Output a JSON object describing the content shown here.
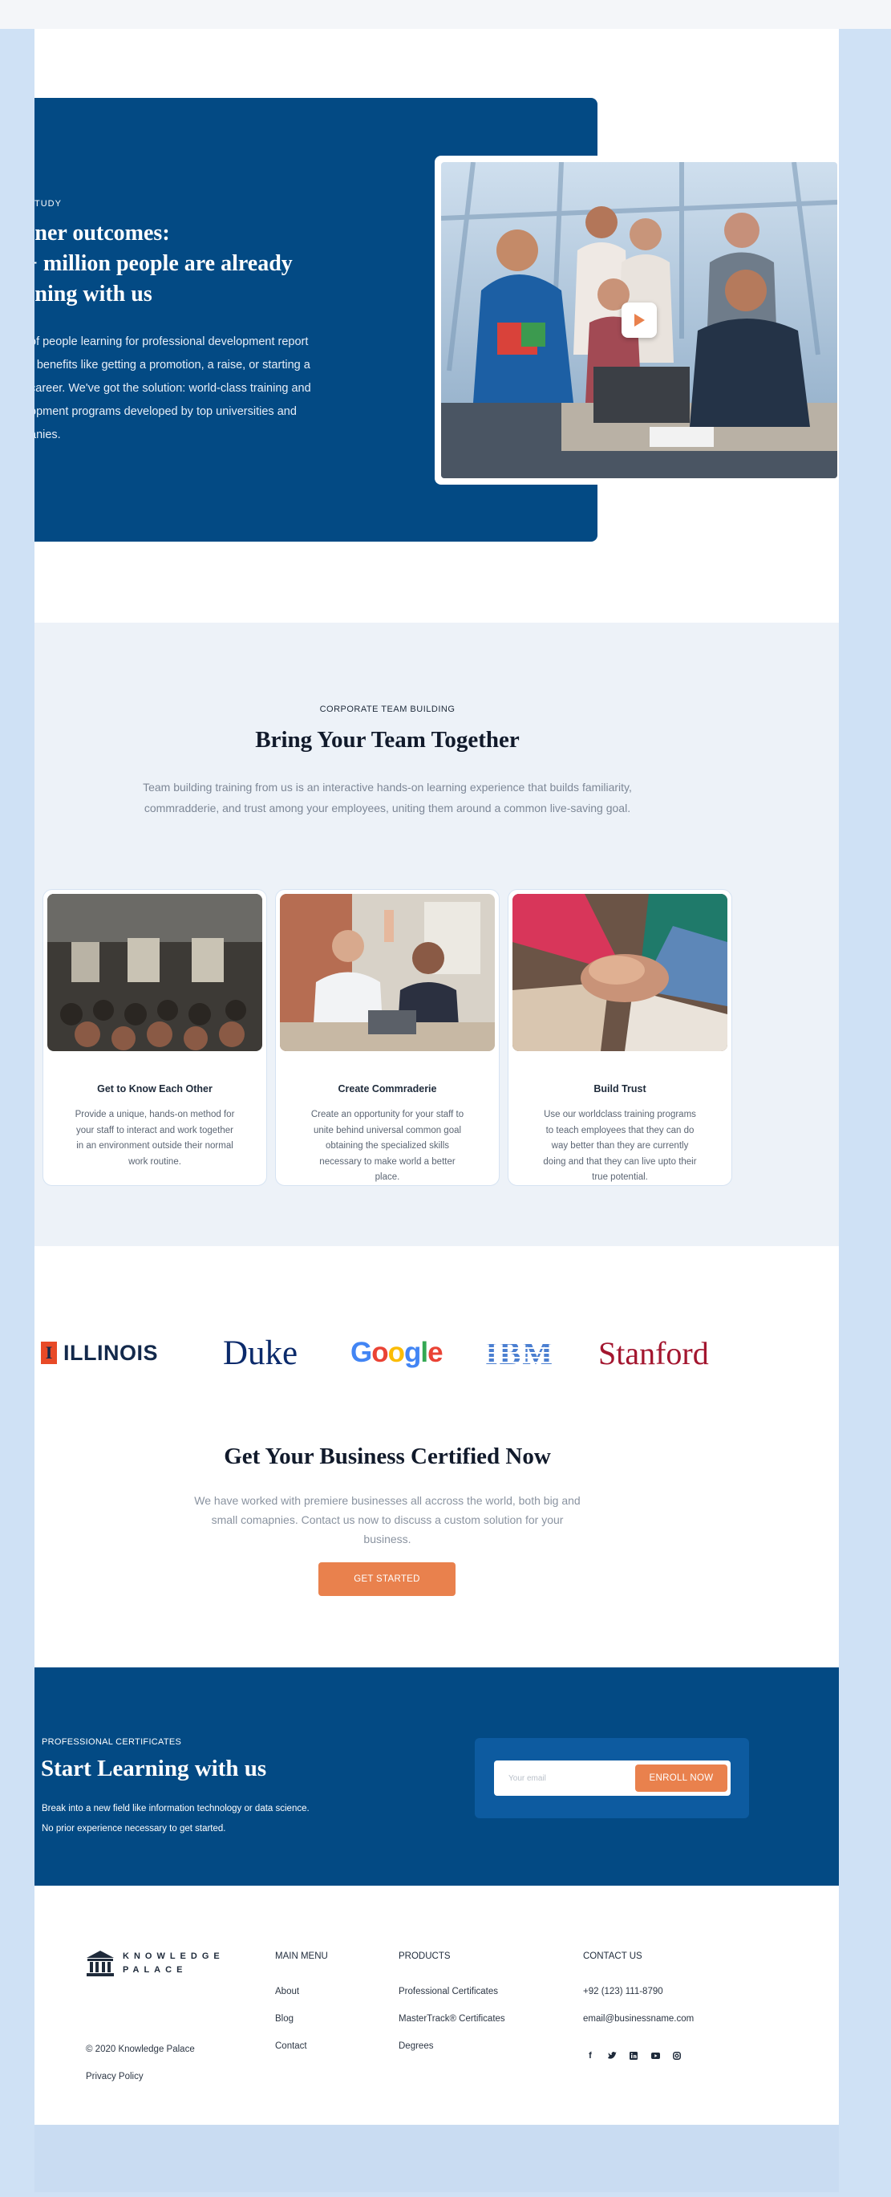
{
  "hero": {
    "eyebrow": "TUDY",
    "title_lines": [
      "rner outcomes:",
      "+ million people are already",
      "rning with us"
    ],
    "body_lines": [
      "of people learning for professional development report",
      "r benefits like getting a promotion, a raise, or starting a",
      "career. We've got the solution: world-class training and",
      "opment programs developed by top universities and",
      "anies."
    ]
  },
  "team": {
    "eyebrow": "CORPORATE TEAM BUILDING",
    "title": "Bring Your Team Together",
    "lead": "Team building training from us is an interactive hands-on learning experience that builds familiarity, commradderie, and trust among your employees, uniting them around a common live-saving goal.",
    "cards": [
      {
        "title": "Get to Know Each Other",
        "text": "Provide a unique, hands-on method for your staff to interact and work together in an environment outside their normal work routine."
      },
      {
        "title": "Create Commraderie",
        "text": "Create an opportunity for your staff to unite behind universal common goal obtaining the specialized skills necessary to make world a better place."
      },
      {
        "title": "Build Trust",
        "text": "Use our worldclass training programs to teach employees that they can do way better than they are currently doing and that they can live upto their true potential."
      }
    ]
  },
  "logos": {
    "illinois": "ILLINOIS",
    "illinois_mark": "I",
    "duke": "Duke",
    "google": [
      "G",
      "o",
      "o",
      "g",
      "l",
      "e"
    ],
    "ibm": "IBM",
    "stanford": "Stanford"
  },
  "certified": {
    "title": "Get Your Business Certified Now",
    "lead": "We have worked with premiere businesses all accross the world, both big and small comapnies. Contact us now to discuss a custom solution for your business.",
    "button": "GET STARTED"
  },
  "cta": {
    "eyebrow": "PROFESSIONAL CERTIFICATES",
    "title": "Start Learning with us",
    "line1": "Break into a new field like information technology or data science.",
    "line2": "No prior experience necessary to get started.",
    "email_placeholder": "Your email",
    "button": "ENROLL NOW"
  },
  "footer": {
    "brand_line1": "KNOWLEDGE",
    "brand_line2": "PALACE",
    "copyright": "© 2020 Knowledge Palace",
    "privacy": "Privacy Policy",
    "main_menu": {
      "heading": "MAIN MENU",
      "items": [
        "About",
        "Blog",
        "Contact"
      ]
    },
    "products": {
      "heading": "PRODUCTS",
      "items": [
        "Professional Certificates",
        "MasterTrack® Certificates",
        "Degrees"
      ]
    },
    "contact": {
      "heading": "CONTACT US",
      "phone": "+92 (123) 111-8790",
      "email": "email@businessname.com"
    },
    "socials": [
      "facebook-icon",
      "twitter-icon",
      "linkedin-icon",
      "youtube-icon",
      "instagram-icon"
    ]
  },
  "colors": {
    "navy": "#034a84",
    "orange": "#e9814d",
    "page_bg": "#cfe1f5",
    "section_tint": "#edf2f8"
  }
}
